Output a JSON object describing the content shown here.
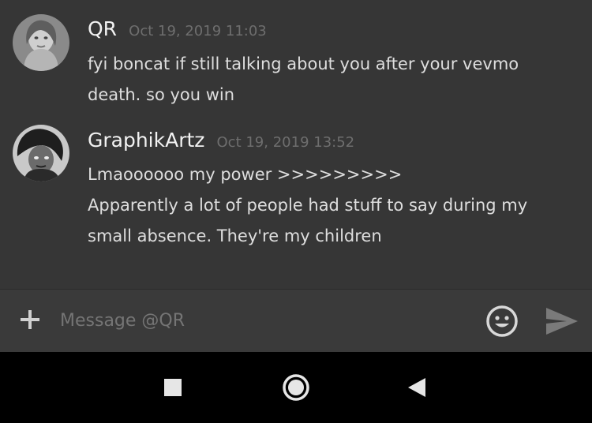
{
  "messages": [
    {
      "author": "QR",
      "timestamp": "Oct 19, 2019 11:03",
      "avatar_icon": "user-avatar-photo",
      "lines": [
        "fyi boncat if still talking about you after your vevmo",
        "death. so you win"
      ]
    },
    {
      "author": "GraphikArtz",
      "timestamp": "Oct 19, 2019 13:52",
      "avatar_icon": "user-avatar-illustration",
      "lines": [
        "Lmaoooooo my power >>>>>>>>>",
        "Apparently a lot of people had stuff to say during my",
        "small absence. They're my children"
      ]
    }
  ],
  "composer": {
    "placeholder": "Message @QR",
    "add_icon": "plus-icon",
    "emoji_icon": "emoji-icon",
    "send_icon": "send-icon"
  },
  "navbar": {
    "recents_icon": "recents-square-icon",
    "home_icon": "home-circle-icon",
    "back_icon": "back-triangle-icon"
  },
  "colors": {
    "chat_background": "#363636",
    "composer_background": "#3a3a3a",
    "navbar_background": "#000000",
    "author_text": "#f2f2f2",
    "message_text": "#dedede",
    "muted_text": "#6e6e6e"
  }
}
